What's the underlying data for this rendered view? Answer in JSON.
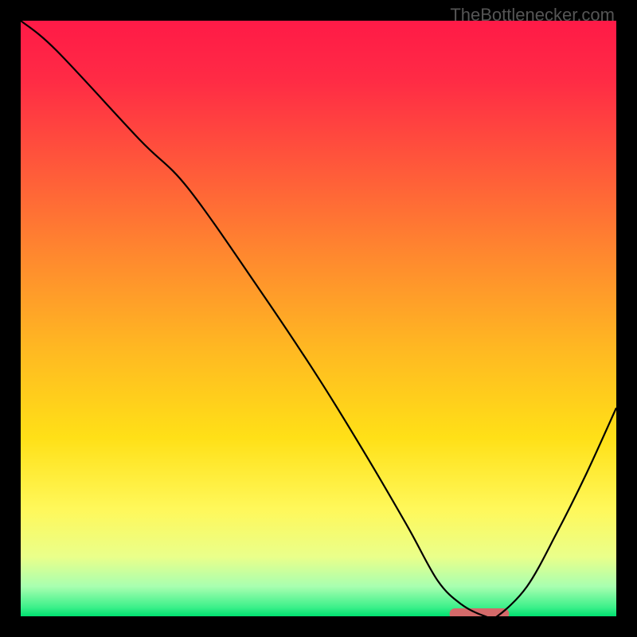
{
  "watermark": "TheBottlenecker.com",
  "chart_data": {
    "type": "line",
    "title": "",
    "xlabel": "",
    "ylabel": "",
    "xlim": [
      0,
      100
    ],
    "ylim": [
      0,
      100
    ],
    "series": [
      {
        "name": "curve",
        "x": [
          0,
          6,
          20,
          28,
          40,
          50,
          58,
          65,
          70,
          74,
          78,
          80,
          85,
          90,
          95,
          100
        ],
        "y": [
          100,
          95,
          80,
          72,
          55,
          40,
          27,
          15,
          6,
          2,
          0,
          0,
          5,
          14,
          24,
          35
        ]
      }
    ],
    "marker": {
      "x_start": 72,
      "x_end": 82,
      "y": 0,
      "color": "#d46a6a"
    },
    "gradient_stops": [
      {
        "offset": 0.0,
        "color": "#ff1a47"
      },
      {
        "offset": 0.1,
        "color": "#ff2b45"
      },
      {
        "offset": 0.25,
        "color": "#ff5a3a"
      },
      {
        "offset": 0.4,
        "color": "#ff8a2e"
      },
      {
        "offset": 0.55,
        "color": "#ffb822"
      },
      {
        "offset": 0.7,
        "color": "#ffe017"
      },
      {
        "offset": 0.82,
        "color": "#fff85a"
      },
      {
        "offset": 0.9,
        "color": "#eaff8a"
      },
      {
        "offset": 0.95,
        "color": "#a8ffb0"
      },
      {
        "offset": 0.985,
        "color": "#3cf08a"
      },
      {
        "offset": 1.0,
        "color": "#00e070"
      }
    ]
  }
}
